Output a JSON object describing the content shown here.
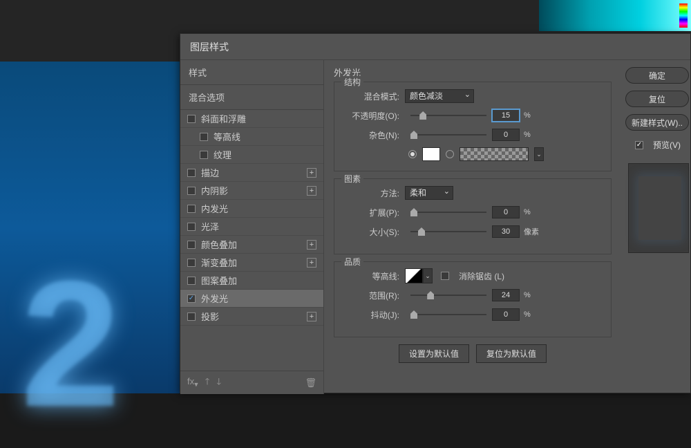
{
  "dialog": {
    "title": "图层样式"
  },
  "stylesPanel": {
    "header": "样式",
    "subheader": "混合选项",
    "items": [
      {
        "label": "斜面和浮雕",
        "checked": false,
        "indent": false,
        "plus": false
      },
      {
        "label": "等高线",
        "checked": false,
        "indent": true,
        "plus": false
      },
      {
        "label": "纹理",
        "checked": false,
        "indent": true,
        "plus": false
      },
      {
        "label": "描边",
        "checked": false,
        "indent": false,
        "plus": true
      },
      {
        "label": "内阴影",
        "checked": false,
        "indent": false,
        "plus": true
      },
      {
        "label": "内发光",
        "checked": false,
        "indent": false,
        "plus": false
      },
      {
        "label": "光泽",
        "checked": false,
        "indent": false,
        "plus": false
      },
      {
        "label": "颜色叠加",
        "checked": false,
        "indent": false,
        "plus": true
      },
      {
        "label": "渐变叠加",
        "checked": false,
        "indent": false,
        "plus": true
      },
      {
        "label": "图案叠加",
        "checked": false,
        "indent": false,
        "plus": false
      },
      {
        "label": "外发光",
        "checked": true,
        "indent": false,
        "plus": false,
        "selected": true
      },
      {
        "label": "投影",
        "checked": false,
        "indent": false,
        "plus": true
      }
    ]
  },
  "settings": {
    "title": "外发光",
    "structure": {
      "legend": "结构",
      "blendModeLabel": "混合模式:",
      "blendModeValue": "颜色减淡",
      "opacityLabel": "不透明度(O):",
      "opacityValue": "15",
      "opacityUnit": "%",
      "noiseLabel": "杂色(N):",
      "noiseValue": "0",
      "noiseUnit": "%"
    },
    "elements": {
      "legend": "图素",
      "methodLabel": "方法:",
      "methodValue": "柔和",
      "spreadLabel": "扩展(P):",
      "spreadValue": "0",
      "spreadUnit": "%",
      "sizeLabel": "大小(S):",
      "sizeValue": "30",
      "sizeUnit": "像素"
    },
    "quality": {
      "legend": "品质",
      "contourLabel": "等高线:",
      "antiAliasLabel": "消除锯齿 (L)",
      "rangeLabel": "范围(R):",
      "rangeValue": "24",
      "rangeUnit": "%",
      "jitterLabel": "抖动(J):",
      "jitterValue": "0",
      "jitterUnit": "%"
    },
    "defaults": {
      "setDefault": "设置为默认值",
      "resetDefault": "复位为默认值"
    }
  },
  "sideButtons": {
    "ok": "确定",
    "cancel": "复位",
    "newStyle": "新建样式(W)..",
    "preview": "预览(V)"
  }
}
